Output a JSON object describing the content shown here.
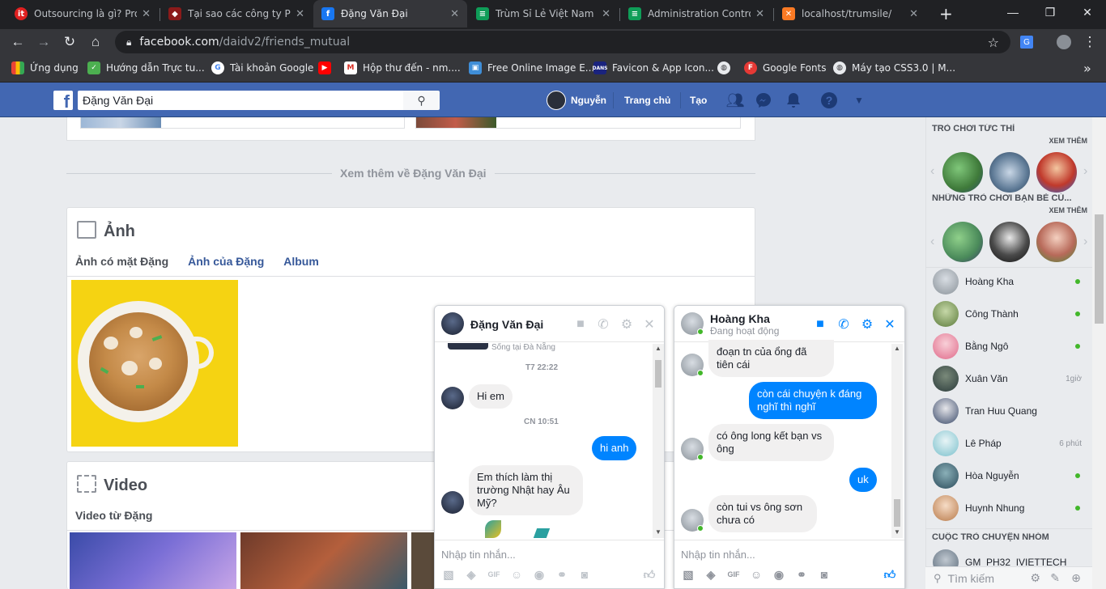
{
  "browser": {
    "tabs": [
      {
        "title": "Outsourcing là gì? Prod",
        "icon": "it-favicon",
        "color": "#e02020"
      },
      {
        "title": "Tại sao các công ty Prod",
        "icon": "car-favicon",
        "color": "#d93025"
      },
      {
        "title": "Đặng Văn Đại",
        "icon": "facebook-favicon",
        "color": "#1877f2"
      },
      {
        "title": "Trùm Sỉ Lẻ Việt Nam",
        "icon": "document-favicon",
        "color": "#0f9d58"
      },
      {
        "title": "Administration Control",
        "icon": "document-favicon",
        "color": "#0f9d58"
      },
      {
        "title": "localhost/trumsile/",
        "icon": "xampp-favicon",
        "color": "#fb7a24"
      }
    ],
    "new_tab": "+",
    "window_controls": {
      "minimize": "—",
      "maximize": "❐",
      "close": "✕"
    },
    "url_host": "facebook.com",
    "url_path": "/daidv2/friends_mutual",
    "bookmarks": [
      {
        "label": "Ứng dụng",
        "icon": "apps-icon",
        "color": "#ea4335"
      },
      {
        "label": "Hướng dẫn Trực tu...",
        "icon": "guide-icon",
        "color": "#4caf50"
      },
      {
        "label": "Tài khoản Google",
        "icon": "google-icon",
        "color": "#4285f4"
      },
      {
        "label": "",
        "icon": "youtube-icon",
        "color": "#ff0000"
      },
      {
        "label": "Hộp thư đến - nm....",
        "icon": "gmail-icon",
        "color": "#d93025"
      },
      {
        "label": "Free Online Image E...",
        "icon": "image-icon",
        "color": "#3f8ed8"
      },
      {
        "label": "Favicon & App Icon...",
        "icon": "dans-icon",
        "color": "#1a237e"
      },
      {
        "label": "",
        "icon": "globe-icon",
        "color": "#e8eaed"
      },
      {
        "label": "Google Fonts",
        "icon": "fonts-icon",
        "color": "#e53935"
      },
      {
        "label": "Máy tạo CSS3.0 | M...",
        "icon": "globe-icon",
        "color": "#e8eaed"
      }
    ]
  },
  "fb": {
    "search_value": "Đặng Văn Đại",
    "nav": {
      "profile": "Nguyễn",
      "home": "Trang chủ",
      "create": "Tạo"
    }
  },
  "main": {
    "see_more": "Xem thêm về Đặng Văn Đại",
    "photos": {
      "title": "Ảnh",
      "tabs": [
        "Ảnh có mặt Đặng",
        "Ảnh của Đặng",
        "Album"
      ]
    },
    "videos": {
      "title": "Video",
      "tabs": [
        "Video từ Đặng"
      ]
    }
  },
  "sidebar": {
    "instant_games": "TRÒ CHƠI TỨC THÌ",
    "see_more_1": "XEM THÊM",
    "friends_games": "NHỮNG TRÒ CHƠI BẠN BÈ CỦ...",
    "see_more_2": "XEM THÊM",
    "contacts": [
      {
        "name": "Hoàng Kha",
        "status": "",
        "online": true
      },
      {
        "name": "Công Thành",
        "status": "",
        "online": true
      },
      {
        "name": "Bằng Ngô",
        "status": "",
        "online": true
      },
      {
        "name": "Xuân Văn",
        "status": "1giờ",
        "online": false
      },
      {
        "name": "Tran Huu Quang",
        "status": "",
        "online": false
      },
      {
        "name": "Lê Pháp",
        "status": "6 phút",
        "online": false
      },
      {
        "name": "Hòa Nguyễn",
        "status": "",
        "online": true
      },
      {
        "name": "Huynh Nhung",
        "status": "",
        "online": true
      }
    ],
    "group_header": "CUỘC TRÒ CHUYỆN NHÓM",
    "group_item": "GM_PH32_IVIETTECH",
    "search_placeholder": "Tìm kiếm"
  },
  "chat1": {
    "name": "Đặng Văn Đại",
    "context": "Sống tại Đà Nẵng",
    "messages": [
      {
        "kind": "time",
        "text": "T7 22:22"
      },
      {
        "kind": "in",
        "text": "Hi em"
      },
      {
        "kind": "time",
        "text": "CN 10:51"
      },
      {
        "kind": "out",
        "text": "hi anh"
      },
      {
        "kind": "in",
        "text": "Em thích làm thị trường Nhật hay Âu Mỹ?"
      }
    ],
    "input_placeholder": "Nhập tin nhắn..."
  },
  "chat2": {
    "name": "Hoàng Kha",
    "status": "Đang hoạt động",
    "messages": [
      {
        "kind": "in",
        "text": "đoạn tn của ổng đã tiên cái"
      },
      {
        "kind": "out",
        "text": "còn cái chuyện k đáng nghĩ thì nghĩ"
      },
      {
        "kind": "in",
        "text": "có ông long kết bạn vs ông"
      },
      {
        "kind": "out",
        "text": "uk"
      },
      {
        "kind": "in",
        "text": "còn tui vs ông sơn chưa có"
      }
    ],
    "input_placeholder": "Nhập tin nhắn..."
  },
  "colors": {
    "fb_blue": "#4267b2",
    "messenger_blue": "#0084ff",
    "online_green": "#42b72a"
  }
}
